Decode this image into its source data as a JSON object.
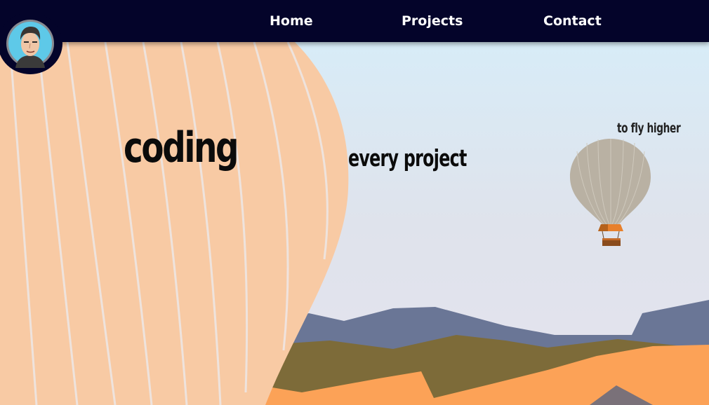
{
  "nav": {
    "links": [
      {
        "label": "Home"
      },
      {
        "label": "Projects"
      },
      {
        "label": "Contact"
      }
    ]
  },
  "hero": {
    "words": {
      "coding": "coding",
      "every_project": "every project",
      "to_fly_higher": "to fly higher"
    }
  },
  "colors": {
    "navbar": "#04042a",
    "sky_top": "#d6eefa",
    "sky_bottom": "#e4e3ee",
    "balloon_large": "#f8caa4",
    "balloon_small": "#b9b1a3",
    "mountain_far": "#6a7696",
    "mountain_mid": "#7d6b39",
    "mountain_near": "#fca257"
  },
  "icons": {
    "avatar": "profile-avatar-illustration"
  }
}
